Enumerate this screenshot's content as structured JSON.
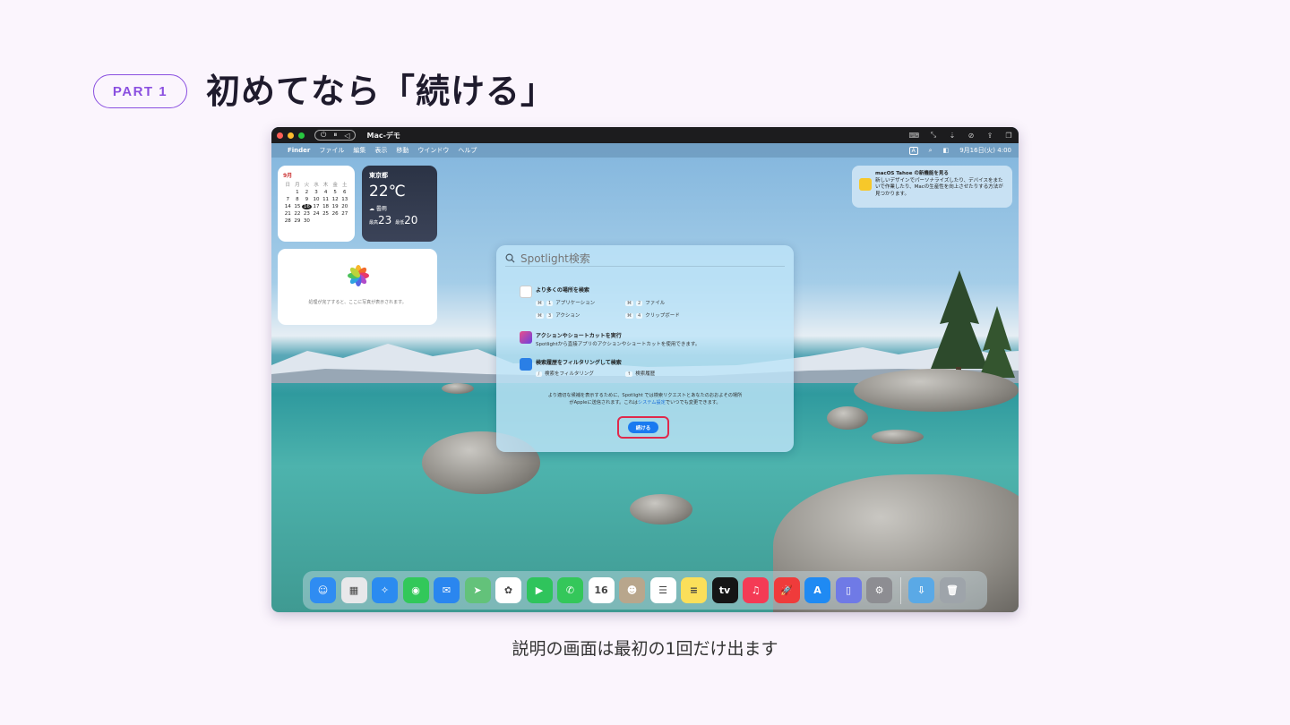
{
  "slide": {
    "badge": "PART 1",
    "heading": "初めてなら「続ける」",
    "caption": "説明の画面は最初の1回だけ出ます"
  },
  "titlebar": {
    "window_title": "Mac-デモ",
    "controls": [
      "⏻",
      "⏸",
      "◁"
    ],
    "right_icons": [
      "⌨",
      "⤡",
      "⇣",
      "⊘",
      "⇪",
      "❐"
    ]
  },
  "menubar": {
    "apple": "",
    "items": [
      "Finder",
      "ファイル",
      "編集",
      "表示",
      "移動",
      "ウインドウ",
      "ヘルプ"
    ],
    "right": {
      "input": "A",
      "search": "⌕",
      "control": "◧",
      "clock": "9月16日(火) 4:00"
    }
  },
  "calendar": {
    "month": "9月",
    "dow": [
      "日",
      "月",
      "火",
      "水",
      "木",
      "金",
      "土"
    ],
    "days": [
      "",
      "1",
      "2",
      "3",
      "4",
      "5",
      "6",
      "7",
      "8",
      "9",
      "10",
      "11",
      "12",
      "13",
      "14",
      "15",
      "16",
      "17",
      "18",
      "19",
      "20",
      "21",
      "22",
      "23",
      "24",
      "25",
      "26",
      "27",
      "28",
      "29",
      "30",
      "",
      "",
      "",
      ""
    ],
    "today": "16"
  },
  "weather": {
    "city": "東京都",
    "temp": "22℃",
    "condition": "曇雨",
    "high_label": "最高",
    "high": "23",
    "low_label": "最低",
    "low": "20"
  },
  "photos": {
    "message": "処理が完了すると、ここに写真が表示されます。"
  },
  "tips": {
    "title": "macOS Tahoe の新機能を見る",
    "body": "新しいデザインでパーソナライズしたり、デバイスをまたいで作業したり、Macの生産性を向上させたりする方法が見つかります。"
  },
  "spotlight": {
    "placeholder": "Spotlight検索",
    "sections": [
      {
        "title": "より多くの場所を検索",
        "shortcuts": [
          {
            "mod": "⌘",
            "key": "1",
            "label": "アプリケーション"
          },
          {
            "mod": "⌘",
            "key": "2",
            "label": "ファイル"
          },
          {
            "mod": "⌘",
            "key": "3",
            "label": "アクション"
          },
          {
            "mod": "⌘",
            "key": "4",
            "label": "クリップボード"
          }
        ]
      },
      {
        "title": "アクションやショートカットを実行",
        "desc": "Spotlightから直接アプリのアクションやショートカットを使用できます。"
      },
      {
        "title": "検索履歴をフィルタリングして検索",
        "shortcuts": [
          {
            "mod": "/",
            "key": "",
            "label": "検索をフィルタリング"
          },
          {
            "mod": "↑",
            "key": "",
            "label": "検索履歴"
          }
        ]
      }
    ],
    "privacy_1": "より適切な候補を表示するために、Spotlight では検索リクエストとあなたのおおよその場所",
    "privacy_2": "がAppleに送信されます。これは",
    "privacy_link": "システム設定",
    "privacy_3": "でいつでも変更できます。",
    "continue_button": "続ける"
  },
  "dock": {
    "apps": [
      {
        "name": "Finder",
        "icon": "finder-icon",
        "color": "#2f8cf2",
        "glyph": "☺"
      },
      {
        "name": "Launchpad",
        "icon": "launchpad-icon",
        "color": "#e8e8ea",
        "glyph": "▦"
      },
      {
        "name": "Safari",
        "icon": "safari-icon",
        "color": "#2b8bf0",
        "glyph": "✧"
      },
      {
        "name": "メッセージ",
        "icon": "messages-icon",
        "color": "#32c85a",
        "glyph": "◉"
      },
      {
        "name": "メール",
        "icon": "mail-icon",
        "color": "#2a86ef",
        "glyph": "✉"
      },
      {
        "name": "マップ",
        "icon": "maps-icon",
        "color": "#63c27a",
        "glyph": "➤"
      },
      {
        "name": "写真",
        "icon": "photos-icon",
        "color": "#ffffff",
        "glyph": "✿"
      },
      {
        "name": "FaceTime",
        "icon": "facetime-icon",
        "color": "#2fc45c",
        "glyph": "▶"
      },
      {
        "name": "電話",
        "icon": "phone-icon",
        "color": "#34c75a",
        "glyph": "✆"
      },
      {
        "name": "カレンダー",
        "icon": "calendar-icon",
        "color": "#ffffff",
        "glyph": "16"
      },
      {
        "name": "連絡先",
        "icon": "contacts-icon",
        "color": "#b8a68c",
        "glyph": "☻"
      },
      {
        "name": "リマインダー",
        "icon": "reminders-icon",
        "color": "#ffffff",
        "glyph": "☰"
      },
      {
        "name": "メモ",
        "icon": "notes-icon",
        "color": "#fbdf5a",
        "glyph": "≡"
      },
      {
        "name": "TV",
        "icon": "tv-icon",
        "color": "#151515",
        "glyph": "tv"
      },
      {
        "name": "ミュージック",
        "icon": "music-icon",
        "color": "#f43b55",
        "glyph": "♫"
      },
      {
        "name": "ゲーム",
        "icon": "games-icon",
        "color": "#ef3b3b",
        "glyph": "🚀"
      },
      {
        "name": "App Store",
        "icon": "app-store-icon",
        "color": "#1f8af3",
        "glyph": "A"
      },
      {
        "name": "iPhone ミラーリング",
        "icon": "iphone-mirroring-icon",
        "color": "#6f7ae6",
        "glyph": "▯"
      },
      {
        "name": "システム設定",
        "icon": "system-settings-icon",
        "color": "#8d8d92",
        "glyph": "⚙"
      }
    ],
    "trailing": [
      {
        "name": "ダウンロード",
        "icon": "downloads-folder-icon",
        "color": "#5aa9e6",
        "glyph": "⇩"
      },
      {
        "name": "ゴミ箱",
        "icon": "trash-icon",
        "color": "#9ea4aa",
        "glyph": "🗑"
      }
    ]
  }
}
